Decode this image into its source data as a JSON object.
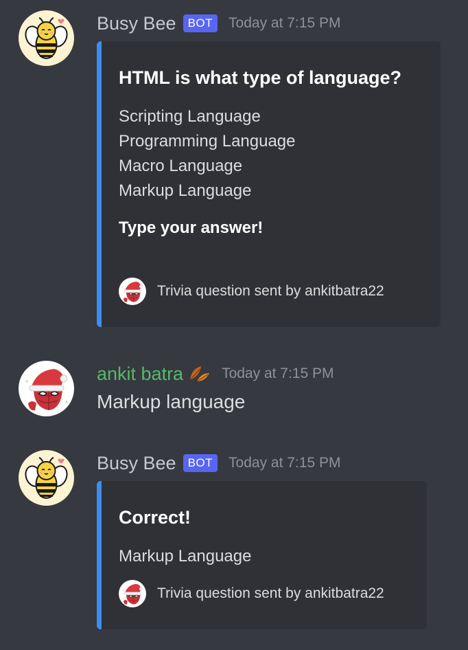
{
  "messages": [
    {
      "author": "Busy Bee",
      "bot_tag": "BOT",
      "timestamp": "Today at 7:15 PM",
      "avatar_icon": "bee-avatar-icon",
      "embed": {
        "accent_color": "#3b8ef0",
        "title": "HTML is what type of language?",
        "options": [
          "Scripting Language",
          "Programming Language",
          "Macro Language",
          "Markup Language"
        ],
        "prompt": "Type your answer!",
        "footer": "Trivia question sent by ankitbatra22"
      }
    },
    {
      "author": "ankit batra",
      "timestamp": "Today at 7:15 PM",
      "avatar_icon": "spiderman-santa-avatar-icon",
      "status_icon": "fallen-leaf-icon",
      "content": "Markup language"
    },
    {
      "author": "Busy Bee",
      "bot_tag": "BOT",
      "timestamp": "Today at 7:15 PM",
      "avatar_icon": "bee-avatar-icon",
      "embed": {
        "accent_color": "#3b8ef0",
        "title": "Correct!",
        "description": "Markup Language",
        "footer": "Trivia question sent by ankitbatra22"
      }
    }
  ],
  "colors": {
    "background": "#36393f",
    "embed_background": "#2f3136",
    "bot_tag": "#5865f2",
    "user_name": "#57b96a"
  }
}
